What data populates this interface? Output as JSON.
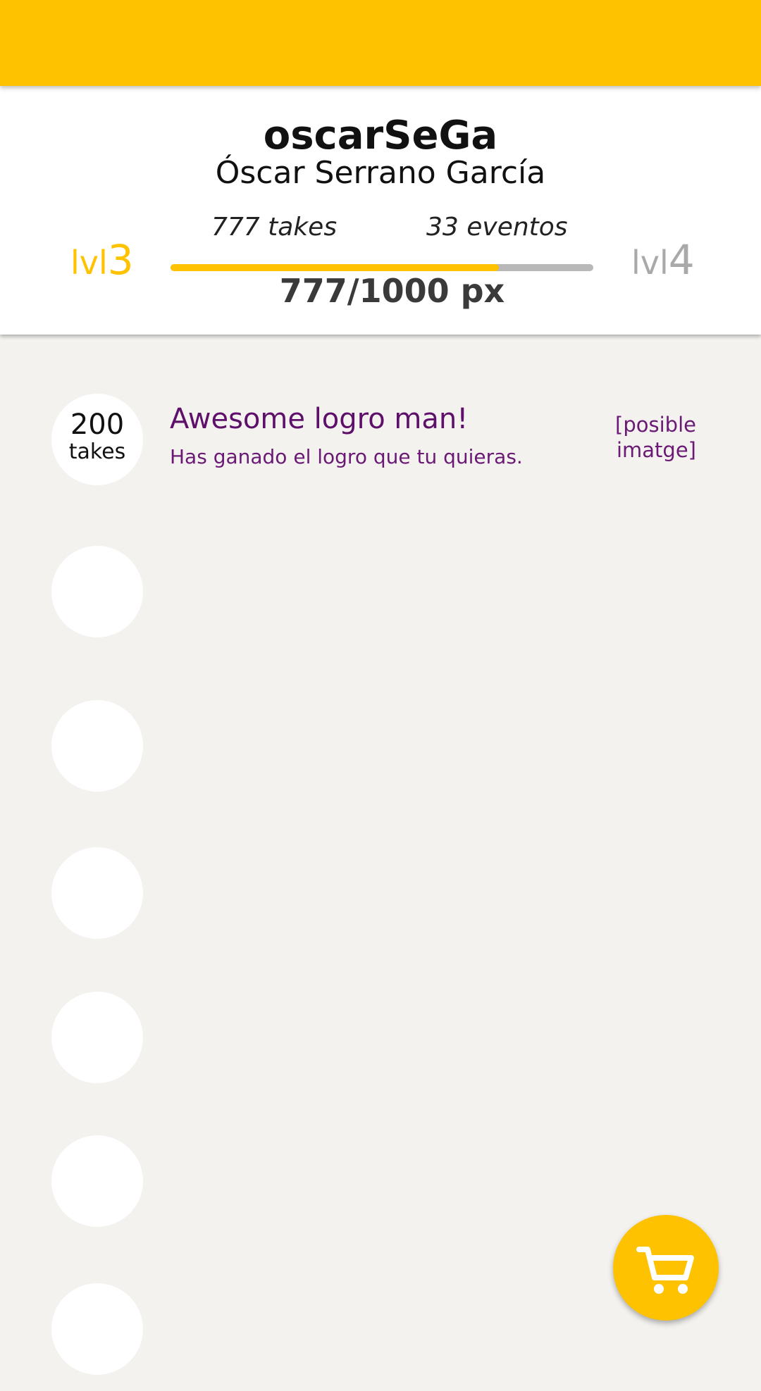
{
  "profile": {
    "username": "oscarSeGa",
    "full_name": "Óscar Serrano García",
    "stats": {
      "takes": "777 takes",
      "events": "33 eventos"
    },
    "current_level": {
      "prefix": "lvl",
      "number": "3"
    },
    "next_level": {
      "prefix": "lvl",
      "number": "4"
    },
    "progress": {
      "label": "777/1000 px",
      "fraction": 0.777
    }
  },
  "achievements": [
    {
      "state": "unlocked",
      "badge_value": "200",
      "badge_unit": "takes",
      "title": "Awesome logro man!",
      "description": "Has ganado el logro que tu quieras.",
      "image_placeholder": "[posible imatge]"
    },
    {
      "state": "unlocked"
    },
    {
      "state": "unlocked"
    },
    {
      "state": "locked"
    },
    {
      "state": "locked"
    },
    {
      "state": "locked"
    },
    {
      "state": "locked"
    }
  ],
  "fab": {
    "icon": "cart-icon"
  },
  "colors": {
    "accent": "#fec200",
    "unlocked": "#fa78f2",
    "locked": "#cdccca",
    "background": "#f3f2ef"
  }
}
